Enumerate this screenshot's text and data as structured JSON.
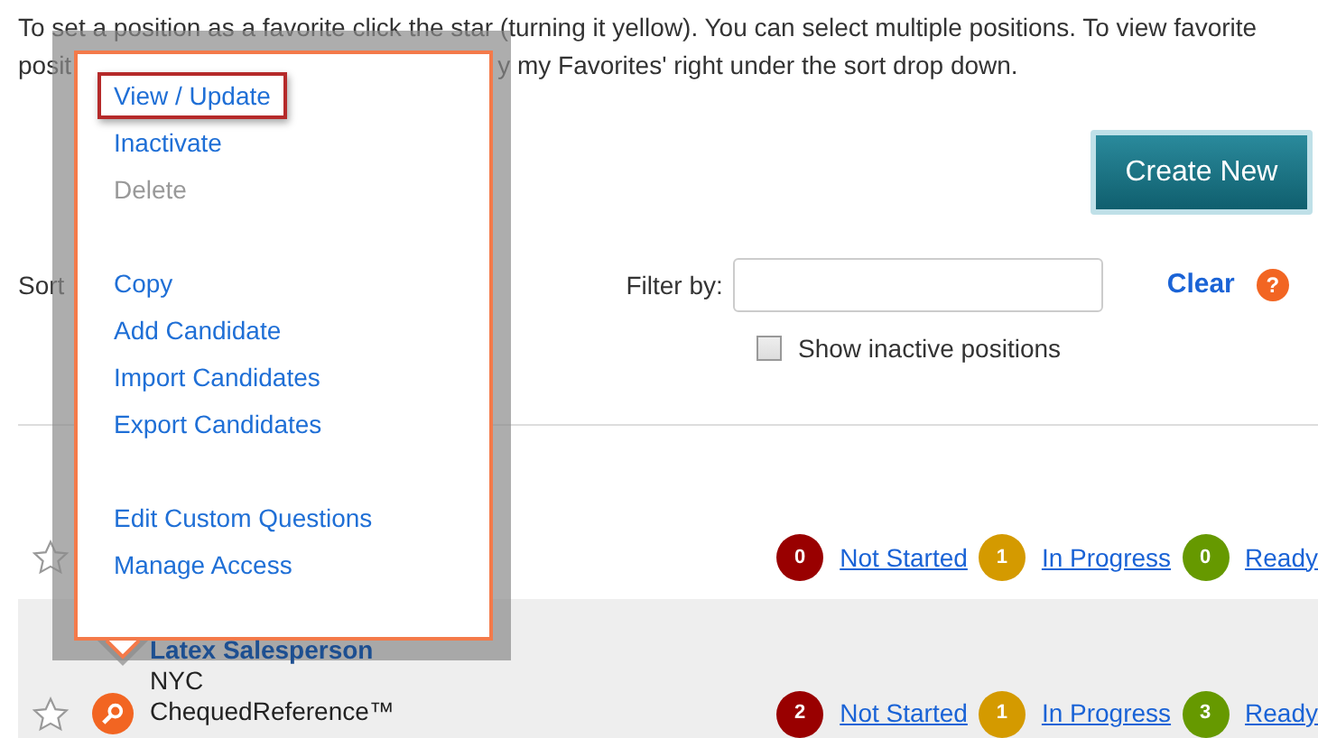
{
  "intro": {
    "line_1": "To set a position as a favorite click the star (turning it yellow). You can select multiple positions. To view favorite",
    "line_2_start": "posit",
    "line_2_end": "y my Favorites' right under the sort drop down."
  },
  "create_button": {
    "label": "Create New"
  },
  "sort": {
    "label": "Sort"
  },
  "filter": {
    "label": "Filter by:",
    "clear": "Clear",
    "help": "?"
  },
  "show_inactive": {
    "label": "Show inactive positions",
    "checked": false
  },
  "rows": [
    {
      "title": "",
      "location": "",
      "product": "",
      "starred": false,
      "hovered": false,
      "statuses": [
        {
          "count": "0",
          "label": "Not Started",
          "color": "#990000"
        },
        {
          "count": "1",
          "label": "In Progress",
          "color": "#d49a00"
        },
        {
          "count": "0",
          "label": "Ready",
          "color": "#669900"
        }
      ]
    },
    {
      "title": "Latex Salesperson",
      "location": "NYC",
      "product": "ChequedReference™",
      "starred": false,
      "hovered": true,
      "statuses": [
        {
          "count": "2",
          "label": "Not Started",
          "color": "#990000"
        },
        {
          "count": "1",
          "label": "In Progress",
          "color": "#d49a00"
        },
        {
          "count": "3",
          "label": "Ready",
          "color": "#669900"
        }
      ]
    }
  ],
  "menu": {
    "groups": [
      [
        {
          "label": "View / Update",
          "selected": true,
          "disabled": false
        },
        {
          "label": "Inactivate",
          "selected": false,
          "disabled": false
        },
        {
          "label": "Delete",
          "selected": false,
          "disabled": true
        }
      ],
      [
        {
          "label": "Copy",
          "selected": false,
          "disabled": false
        },
        {
          "label": "Add Candidate",
          "selected": false,
          "disabled": false
        },
        {
          "label": "Import Candidates",
          "selected": false,
          "disabled": false
        },
        {
          "label": "Export Candidates",
          "selected": false,
          "disabled": false
        }
      ],
      [
        {
          "label": "Edit Custom Questions",
          "selected": false,
          "disabled": false
        },
        {
          "label": "Manage Access",
          "selected": false,
          "disabled": false
        }
      ]
    ]
  }
}
